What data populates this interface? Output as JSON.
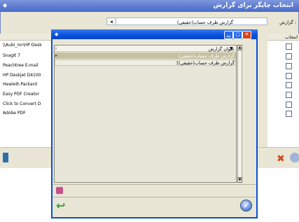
{
  "back_window": {
    "title": "انتخاب چاپگر برای گزارش",
    "report_label": "گزارش :",
    "report_value": "گزارش طرف حساب(حقیقی)",
    "select_header": "انتخاب",
    "printers": [
      "\\\\Aubi_mr\\HP Desk",
      "SnagIt 7",
      "Peachtree E-mail",
      "HP Deskjet D4100",
      "Hewlett-Packard",
      "Easy PDF Creator",
      "Click to Convert D",
      "Adobe PDF"
    ]
  },
  "dialog": {
    "column_header": "عنوان گزارش",
    "rows": [
      "گزارش طرف حساب(حقیقی)",
      "[گزارش طرف حساب(حقیقی)"
    ]
  },
  "colors": {
    "titlebar": "#0c55e0",
    "panel": "#e9e6d5",
    "selected_row": "#c8c0a2"
  }
}
